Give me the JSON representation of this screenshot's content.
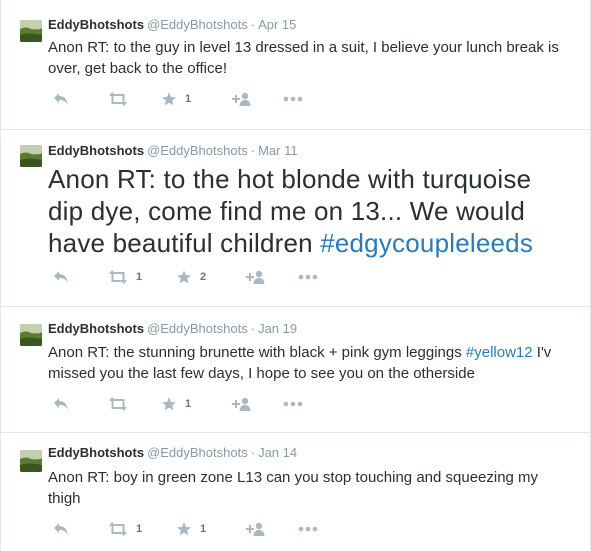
{
  "colors": {
    "border": "#e1e8ed",
    "muted": "#8899a6",
    "icon": "#aab8c2",
    "hashtag": "#2b7bb9",
    "text": "#292f33"
  },
  "tweets": [
    {
      "name": "EddyBhotshots",
      "handle": "@EddyBhotshots",
      "separator": "·",
      "time": "Apr 15",
      "text": "Anon RT: to the guy in level 13 dressed in a suit, I believe your lunch break is over, get back to the office!",
      "retweet_count": "",
      "favorite_count": "1",
      "icons": [
        "reply-icon",
        "retweet-icon",
        "favorite-star-icon",
        "follow-icon",
        "more-icon"
      ]
    },
    {
      "name": "EddyBhotshots",
      "handle": "@EddyBhotshots",
      "separator": "·",
      "time": "Mar 11",
      "text_main": "Anon RT: to the hot blonde with turquoise dip dye, come find me on 13... We would have beautiful children ",
      "hashtag": "#edgycoupleleeds",
      "retweet_count": "1",
      "favorite_count": "2",
      "icons": [
        "reply-icon",
        "retweet-icon",
        "favorite-star-icon",
        "follow-icon",
        "more-icon"
      ]
    },
    {
      "name": "EddyBhotshots",
      "handle": "@EddyBhotshots",
      "separator": "·",
      "time": "Jan 19",
      "text_before": "Anon RT: the stunning brunette with black + pink gym leggings ",
      "hashtag": "#yellow12",
      "text_after": " I'v missed you the last few days, I hope to see you on the otherside",
      "retweet_count": "",
      "favorite_count": "1",
      "icons": [
        "reply-icon",
        "retweet-icon",
        "favorite-star-icon",
        "follow-icon",
        "more-icon"
      ]
    },
    {
      "name": "EddyBhotshots",
      "handle": "@EddyBhotshots",
      "separator": "·",
      "time": "Jan 14",
      "text": "Anon RT: boy in green zone L13 can you stop touching and squeezing my thigh",
      "retweet_count": "1",
      "favorite_count": "1",
      "icons": [
        "reply-icon",
        "retweet-icon",
        "favorite-star-icon",
        "follow-icon",
        "more-icon"
      ]
    }
  ]
}
